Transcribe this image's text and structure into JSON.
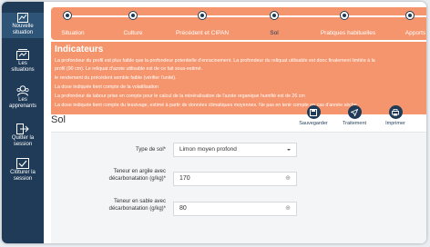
{
  "sidebar": {
    "items": [
      {
        "label_line1": "Nouvelle",
        "label_line2": "situation",
        "icon": "new-situation-icon"
      },
      {
        "label_line1": "Les",
        "label_line2": "situations",
        "icon": "situations-icon"
      },
      {
        "label_line1": "Les",
        "label_line2": "apprenants",
        "icon": "learners-icon"
      },
      {
        "label_line1": "Quitter la",
        "label_line2": "session",
        "icon": "exit-icon"
      },
      {
        "label_line1": "Clôturer la",
        "label_line2": "session",
        "icon": "close-session-icon"
      }
    ]
  },
  "stepper": {
    "steps": [
      "Situation",
      "Culture",
      "Précédent et CIPAN",
      "Sol",
      "Pratiques habituelles",
      "Apports"
    ],
    "current": "Sol"
  },
  "indicateurs": {
    "title": "Indicateurs",
    "lines": [
      "La profondeur du profil est plus faible que la profondeur potentielle d'enracinement. La profondeur du reliquat utilisable est donc finalement limitée à la",
      "profil (90 cm). Le reliquat d'azote utilisable est de ce fait sous-estimé.",
      "le rendement du précédent semble faible (vérifier l'unité).",
      "La dose indiquée tient compte de la volatilisation",
      "La profondeur de labour prise en compte pour le calcul de la minéralisation de l'azote organique humifié est de 26 cm",
      "La dose indiquée tient compte du lessivage, estimé à partir de données climatiques moyennes. Ne pas en tenir compte en cas d'année sèche."
    ]
  },
  "section_title": "Sol",
  "actions": {
    "save": "Sauvegarder",
    "treatment": "Traitement",
    "print": "Imprimer"
  },
  "form": {
    "soil_type_label": "Type de sol",
    "required_mark": "*",
    "soil_type_value": "Limon moyen profond",
    "clay_label_line1": "Teneur en argile avec",
    "clay_label_line2": "décarbonatation (g/kg)",
    "clay_value": "170",
    "sand_label_line1": "Teneur en sable avec",
    "sand_label_line2": "décarbonatation (g/kg)",
    "sand_value": "80"
  },
  "colors": {
    "sidebar": "#1f3b57",
    "accent": "#f4956d"
  }
}
